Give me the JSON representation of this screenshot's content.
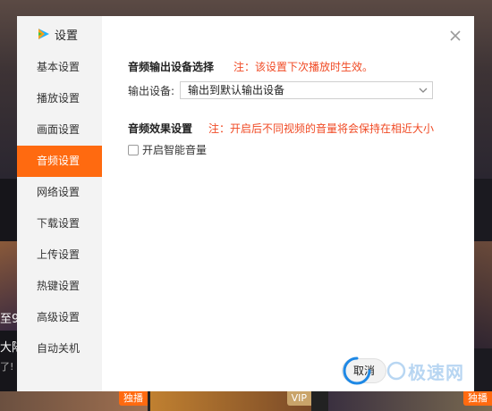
{
  "dialog": {
    "title": "设置",
    "close_icon": "close-icon",
    "nav": [
      {
        "label": "基本设置",
        "active": false
      },
      {
        "label": "播放设置",
        "active": false
      },
      {
        "label": "画面设置",
        "active": false
      },
      {
        "label": "音频设置",
        "active": true
      },
      {
        "label": "网络设置",
        "active": false
      },
      {
        "label": "下载设置",
        "active": false
      },
      {
        "label": "上传设置",
        "active": false
      },
      {
        "label": "热键设置",
        "active": false
      },
      {
        "label": "高级设置",
        "active": false
      },
      {
        "label": "自动关机",
        "active": false
      }
    ],
    "audio_output": {
      "title": "音频输出设备选择",
      "note": "注：该设置下次播放时生效。",
      "device_label": "输出设备:",
      "device_value": "输出到默认输出设备"
    },
    "audio_effect": {
      "title": "音频效果设置",
      "note": "注：开启后不同视频的音量将会保持在相近大小",
      "smart_volume_label": "开启智能音量",
      "smart_volume_checked": false
    },
    "cancel_label": "取消",
    "watermark_text": "极速网",
    "accent_color": "#ff6a10",
    "note_color": "#f04a24"
  },
  "background": {
    "left_fragments": [
      "至9",
      "大陆",
      "了!"
    ],
    "badges": [
      "独播",
      "VIP",
      "独播"
    ]
  }
}
